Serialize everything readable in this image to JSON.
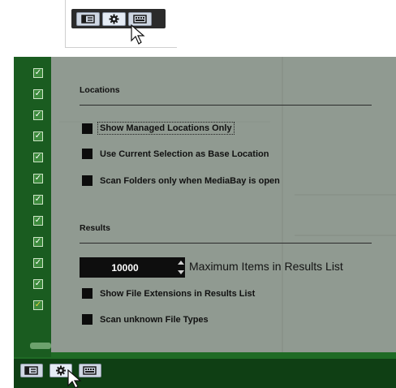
{
  "top_toolbar": {
    "buttons": [
      {
        "name": "layout-icon"
      },
      {
        "name": "gear-icon"
      },
      {
        "name": "keyboard-icon"
      }
    ]
  },
  "left_column": {
    "checkboxes": [
      {
        "checked": true
      },
      {
        "checked": true
      },
      {
        "checked": true
      },
      {
        "checked": true
      },
      {
        "checked": true
      },
      {
        "checked": true
      },
      {
        "checked": true
      },
      {
        "checked": true
      },
      {
        "checked": true
      },
      {
        "checked": true
      },
      {
        "checked": true
      },
      {
        "checked": true,
        "color": "#e6d437"
      }
    ]
  },
  "settings": {
    "locations": {
      "title": "Locations",
      "options": [
        {
          "label": "Show Managed Locations Only",
          "checked": true,
          "focused": true
        },
        {
          "label": "Use Current Selection as Base Location",
          "checked": true
        },
        {
          "label": "Scan Folders only when MediaBay is open",
          "checked": true
        }
      ]
    },
    "results": {
      "title": "Results",
      "max_items_value": "10000",
      "max_items_label": "Maximum Items in Results List",
      "options": [
        {
          "label": "Show File Extensions in Results List",
          "checked": true
        },
        {
          "label": "Scan unknown File Types",
          "checked": true
        }
      ]
    }
  },
  "bottom_toolbar": {
    "buttons": [
      {
        "name": "layout-icon"
      },
      {
        "name": "gear-icon"
      },
      {
        "name": "keyboard-icon"
      }
    ]
  },
  "colors": {
    "window_green": "#1f6b25",
    "panel_gray": "#909a91",
    "toolbar_dark": "#2b2b2b"
  }
}
